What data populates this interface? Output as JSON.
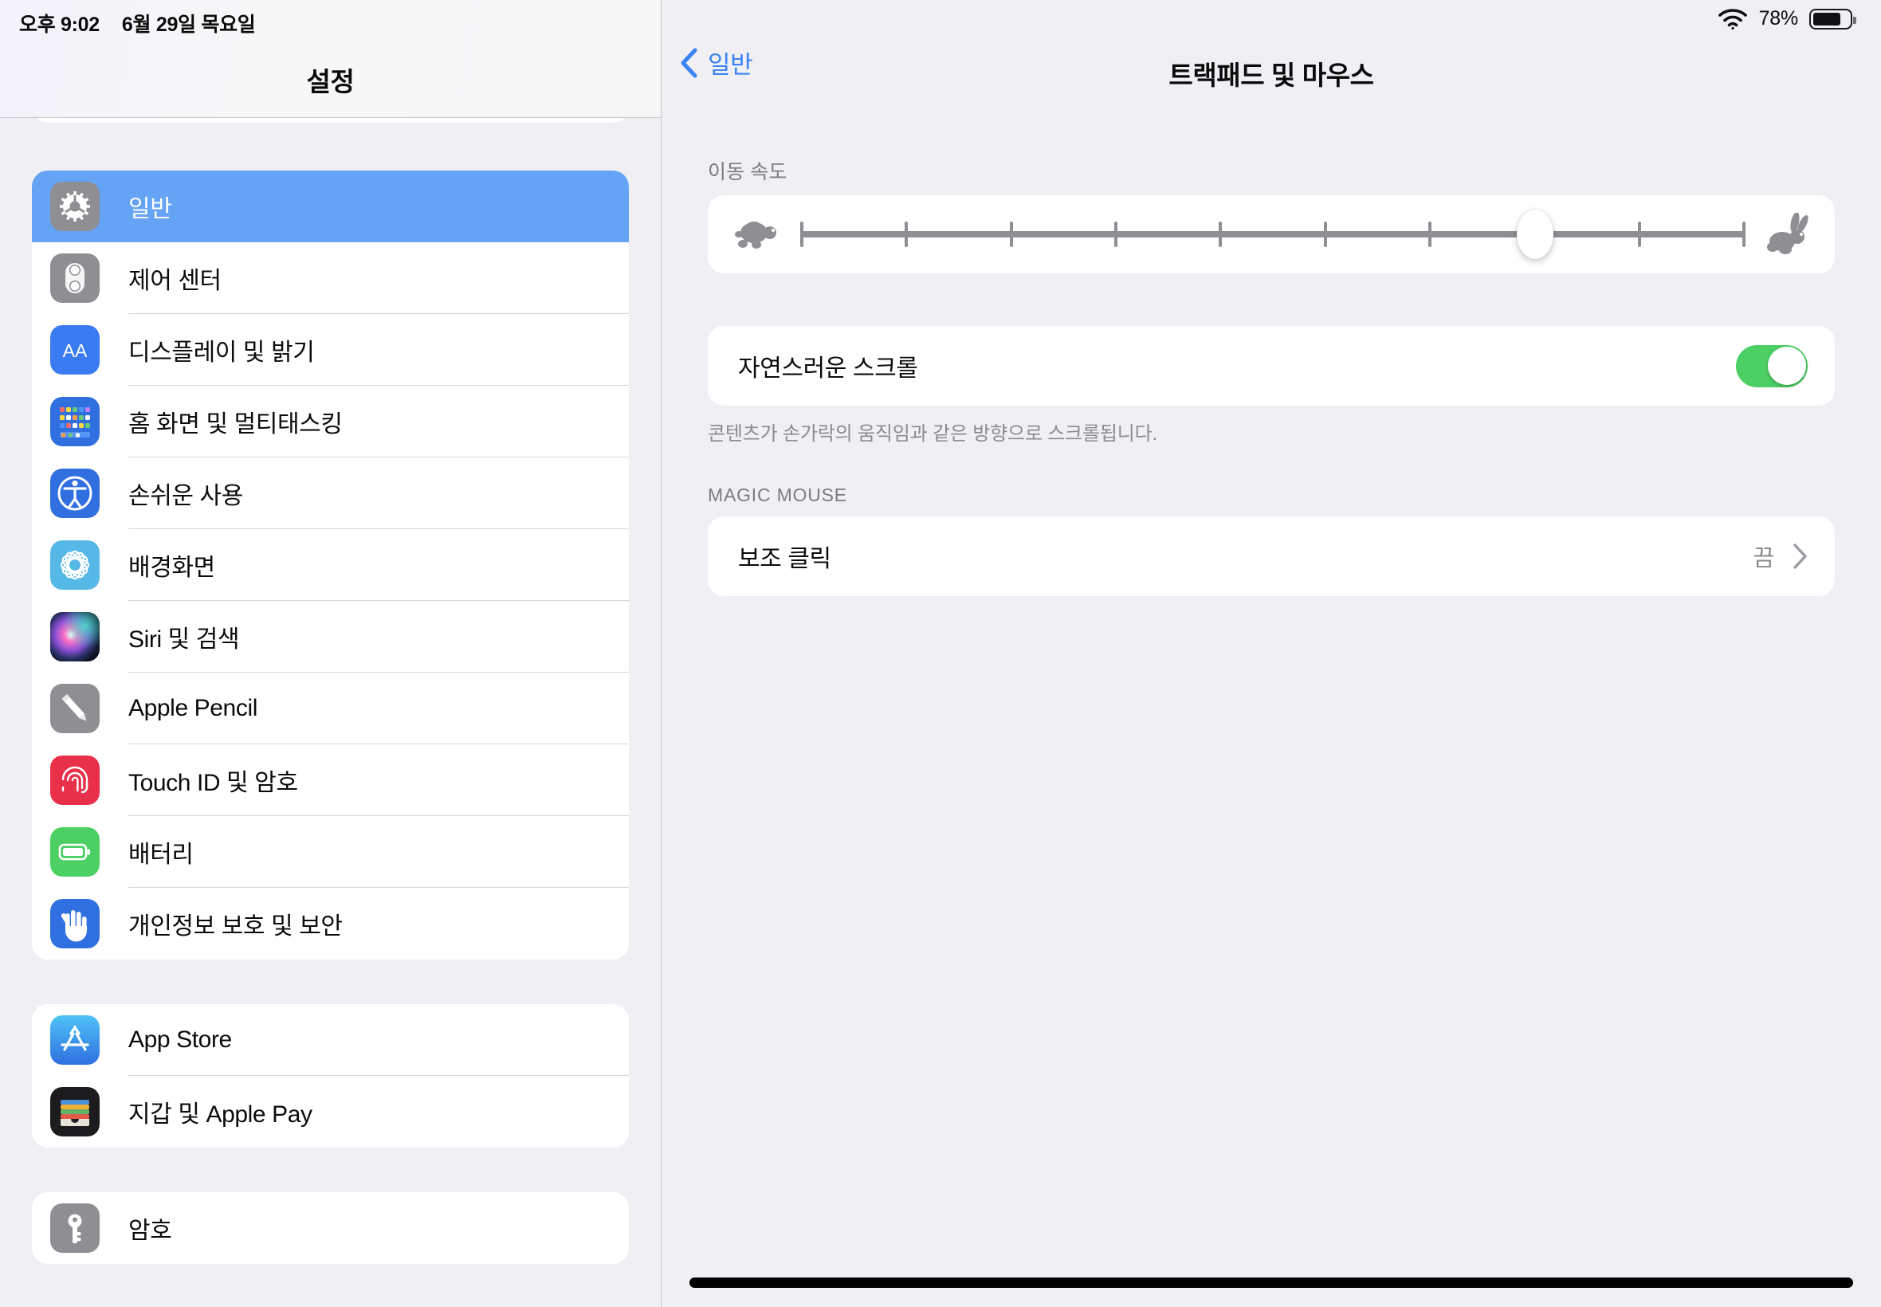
{
  "status_bar": {
    "time": "오후 9:02",
    "date": "6월 29일 목요일",
    "battery_percent": "78%",
    "wifi_icon": "wifi-icon",
    "battery_icon": "battery-icon",
    "battery_level": 78
  },
  "sidebar": {
    "title": "설정",
    "groups": [
      {
        "items": [
          {
            "label": "",
            "icon": "podcasts-icon",
            "icon_color": "#5b55d6",
            "selected": false,
            "clipped": true
          }
        ]
      },
      {
        "items": [
          {
            "label": "일반",
            "icon": "gear-icon",
            "icon_color": "#8e8e93",
            "selected": true
          },
          {
            "label": "제어 센터",
            "icon": "control-center-icon",
            "icon_color": "#8e8e93",
            "selected": false
          },
          {
            "label": "디스플레이 및 밝기",
            "icon": "display-brightness-icon",
            "icon_color": "#3a7bf2",
            "selected": false
          },
          {
            "label": "홈 화면 및 멀티태스킹",
            "icon": "home-screen-icon",
            "icon_color": "#2f6fe0",
            "selected": false
          },
          {
            "label": "손쉬운 사용",
            "icon": "accessibility-icon",
            "icon_color": "#2f6fe0",
            "selected": false
          },
          {
            "label": "배경화면",
            "icon": "wallpaper-icon",
            "icon_color": "#56b8e6",
            "selected": false
          },
          {
            "label": "Siri 및 검색",
            "icon": "siri-icon",
            "icon_color": "#1d1b2b",
            "selected": false
          },
          {
            "label": "Apple Pencil",
            "icon": "pencil-icon",
            "icon_color": "#8e8e93",
            "selected": false
          },
          {
            "label": "Touch ID 및 암호",
            "icon": "touch-id-icon",
            "icon_color": "#e8304b",
            "selected": false
          },
          {
            "label": "배터리",
            "icon": "battery-settings-icon",
            "icon_color": "#4cd063",
            "selected": false
          },
          {
            "label": "개인정보 보호 및 보안",
            "icon": "privacy-hand-icon",
            "icon_color": "#2f6fe0",
            "selected": false
          }
        ]
      },
      {
        "items": [
          {
            "label": "App Store",
            "icon": "app-store-icon",
            "icon_color": "#3aa0f5",
            "selected": false
          },
          {
            "label": "지갑 및 Apple Pay",
            "icon": "wallet-icon",
            "icon_color": "#1c1c1e",
            "selected": false
          }
        ]
      },
      {
        "items": [
          {
            "label": "암호",
            "icon": "key-icon",
            "icon_color": "#8e8e93",
            "selected": false
          }
        ]
      }
    ]
  },
  "content": {
    "back_label": "일반",
    "title": "트랙패드 및 마우스",
    "tracking_speed": {
      "label": "이동 속도",
      "slow_icon": "turtle-icon",
      "fast_icon": "rabbit-icon",
      "tick_count": 10,
      "value_index": 7,
      "value_percent": 78
    },
    "natural_scroll": {
      "label": "자연스러운 스크롤",
      "enabled": true,
      "toggle_color": "#4cd063",
      "footer": "콘텐츠가 손가락의 움직임과 같은 방향으로 스크롤됩니다."
    },
    "magic_mouse": {
      "section_header": "MAGIC MOUSE",
      "secondary_click": {
        "label": "보조 클릭",
        "value": "끔",
        "chevron_icon": "chevron-right-icon"
      }
    },
    "annotation": {
      "shape": "hand-drawn-ellipse",
      "color": "#e8646e"
    },
    "pointer": {
      "shape": "circle-cursor",
      "color": "#aeaeb4"
    }
  },
  "accent_colors": {
    "selection_blue": "#65a3f5",
    "link_blue": "#3a83f4",
    "toggle_green": "#4cd063",
    "annotation_red": "#e8646e",
    "page_background": "#f0eff4"
  }
}
